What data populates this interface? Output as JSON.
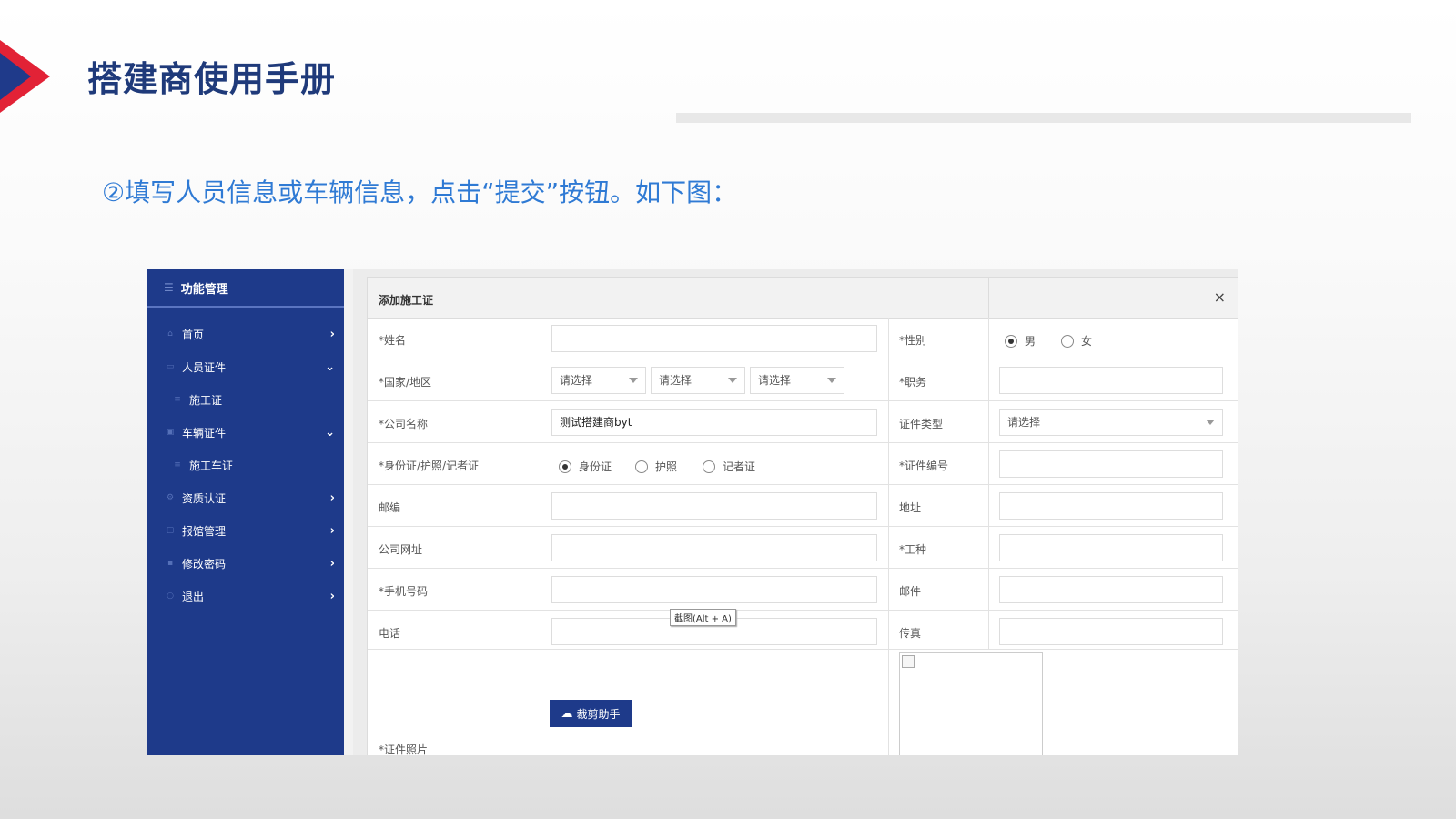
{
  "page": {
    "title": "搭建商使用手册",
    "instruction": "②填写人员信息或车辆信息，点击“提交”按钮。如下图："
  },
  "sidebar": {
    "header": "功能管理",
    "items": [
      {
        "label": "首页",
        "icon": "home-icon"
      },
      {
        "label": "人员证件",
        "icon": "id-card-icon"
      },
      {
        "label": "施工证",
        "icon": "list-icon"
      },
      {
        "label": "车辆证件",
        "icon": "car-icon"
      },
      {
        "label": "施工车证",
        "icon": "list-icon"
      },
      {
        "label": "资质认证",
        "icon": "gear-icon"
      },
      {
        "label": "报馆管理",
        "icon": "folder-icon"
      },
      {
        "label": "修改密码",
        "icon": "lock-icon"
      },
      {
        "label": "退出",
        "icon": "power-icon"
      }
    ]
  },
  "dialog": {
    "title": "添加施工证",
    "close": "×",
    "fields": {
      "name": "*姓名",
      "gender": "*性别",
      "gender_male": "男",
      "gender_female": "女",
      "country": "*国家/地区",
      "position": "*职务",
      "company": "*公司名称",
      "company_value": "测试搭建商byt",
      "cert_type": "证件类型",
      "id_type": "*身份证/护照/记者证",
      "id_card": "身份证",
      "passport": "护照",
      "press_card": "记者证",
      "cert_no": "*证件编号",
      "postcode": "邮编",
      "address": "地址",
      "website": "公司网址",
      "job_type": "*工种",
      "mobile": "*手机号码",
      "email": "邮件",
      "phone": "电话",
      "fax": "传真",
      "photo": "*证件照片",
      "select_placeholder": "请选择"
    },
    "tooltip": "截图(Alt + A)",
    "crop_button": "裁剪助手"
  },
  "colors": {
    "sidebar_bg": "#1e3a8a",
    "title_color": "#1f3a7a",
    "instruction_color": "#2f7ad4",
    "accent_red": "#e22236"
  }
}
